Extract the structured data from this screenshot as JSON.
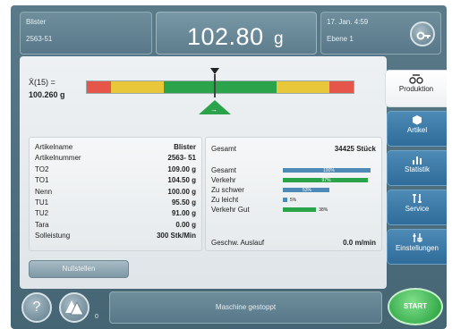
{
  "header": {
    "product_name": "Blister",
    "article_number": "2563-51",
    "weight_value": "102.80",
    "weight_unit": "g",
    "datetime": "17. Jan. 4:59",
    "level": "Ebene 1"
  },
  "gauge": {
    "mean_label": "X̄(15) =",
    "mean_value": "100.260 g",
    "pointer_level": 0.52,
    "colors": {
      "red": "#e6554a",
      "yellow": "#e8c83a",
      "green": "#2aa34a"
    }
  },
  "details_left": [
    {
      "label": "Artikelname",
      "value": "Blister"
    },
    {
      "label": "Artikelnummer",
      "value": "2563- 51"
    },
    {
      "label": "TO2",
      "value": "109.00 g"
    },
    {
      "label": "TO1",
      "value": "104.50 g"
    },
    {
      "label": "Nenn",
      "value": "100.00 g"
    },
    {
      "label": "TU1",
      "value": "95.50 g"
    },
    {
      "label": "TU2",
      "value": "91.00 g"
    },
    {
      "label": "Tara",
      "value": "0.00 g"
    },
    {
      "label": "Solleistung",
      "value": "300 Stk/Min"
    }
  ],
  "details_right": {
    "total_label": "Gesamt",
    "total_value": "34425 Stück",
    "distribution": [
      {
        "label": "Gesamt",
        "percent_label": "100%",
        "percent": 100,
        "color": "#4e8ab6"
      },
      {
        "label": "Verkehr",
        "percent_label": "97%",
        "percent": 97,
        "color": "#2aa34a"
      },
      {
        "label": "Zu schwer",
        "percent_label": "53%",
        "percent": 53,
        "color": "#4e8ab6"
      },
      {
        "label": "Zu leicht",
        "percent_label": "5%",
        "percent": 5,
        "color": "#4e8ab6"
      },
      {
        "label": "Verkehr Gut",
        "percent_label": "38%",
        "percent": 38,
        "color": "#2aa34a"
      }
    ],
    "speed_label": "Geschw. Auslauf",
    "speed_value": "0.0  m/min"
  },
  "reset_button": "Nullstellen",
  "tabs": [
    {
      "label": "Produktion",
      "icon": "scale-icon",
      "active": true
    },
    {
      "label": "Artikel",
      "icon": "cube-icon",
      "active": false
    },
    {
      "label": "Statistik",
      "icon": "bar-chart-icon",
      "active": false
    },
    {
      "label": "Service",
      "icon": "tools-icon",
      "active": false
    },
    {
      "label": "Einstellungen",
      "icon": "settings-icon",
      "active": false
    }
  ],
  "footer": {
    "help_label": "?",
    "counter": "0",
    "status": "Maschine gestoppt",
    "start_label": "START"
  }
}
